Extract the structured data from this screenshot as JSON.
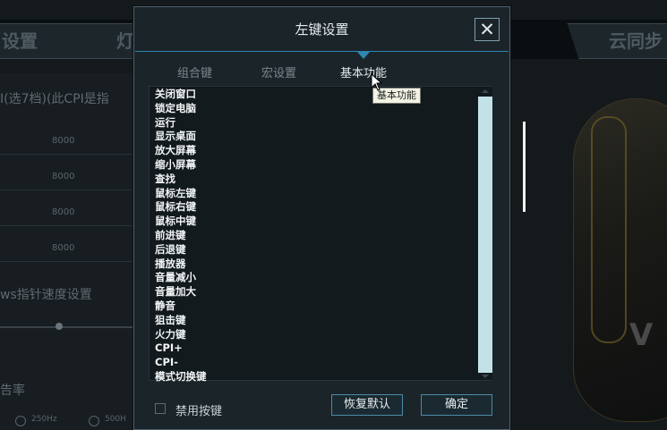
{
  "background": {
    "tabs": {
      "left": "设置",
      "mid": "灯",
      "right": "云同步"
    },
    "cpi_title": "I(选7档)(此CPI是指",
    "cpi_rows": [
      "8000",
      "8000",
      "8000",
      "8000"
    ],
    "pointer_title": "ws指针速度设置",
    "rate_title": "告率",
    "rate_options": [
      "250Hz",
      "500H"
    ],
    "mouse_logo": "V"
  },
  "dialog": {
    "title": "左键设置",
    "close_symbol": "✕",
    "tabs": [
      {
        "label": "组合键"
      },
      {
        "label": "宏设置"
      },
      {
        "label": "基本功能"
      }
    ],
    "tooltip": "基本功能",
    "functions": [
      "关闭窗口",
      "锁定电脑",
      "运行",
      "显示桌面",
      "放大屏幕",
      "缩小屏幕",
      "查找",
      "鼠标左键",
      "鼠标右键",
      "鼠标中键",
      "前进键",
      "后退键",
      "播放器",
      "音量减小",
      "音量加大",
      "静音",
      "狙击键",
      "火力键",
      "CPI+",
      "CPI-",
      "模式切换键"
    ],
    "disable_label": "禁用按键",
    "reset_label": "恢复默认",
    "ok_label": "确定"
  }
}
